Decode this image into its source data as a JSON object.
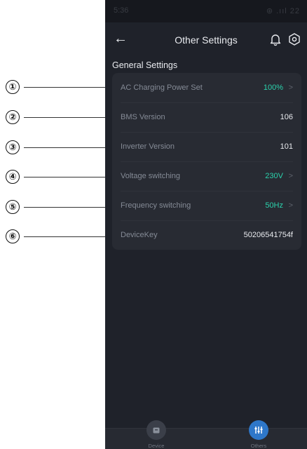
{
  "callouts": [
    "①",
    "②",
    "③",
    "④",
    "⑤",
    "⑥"
  ],
  "status_bar": {
    "time": "5:36",
    "indicators": "⊛ .ııl 22"
  },
  "header": {
    "back_icon": "←",
    "title": "Other Settings"
  },
  "section": {
    "title": "General Settings"
  },
  "settings": [
    {
      "label": "AC Charging Power Set",
      "value": "100%",
      "chevron": ">"
    },
    {
      "label": "BMS Version",
      "value": "106"
    },
    {
      "label": "Inverter Version",
      "value": "101"
    },
    {
      "label": "Voltage switching",
      "value": "230V",
      "chevron": ">"
    },
    {
      "label": "Frequency switching",
      "value": "50Hz",
      "chevron": ">"
    },
    {
      "label": "DeviceKey",
      "value": "50206541754f"
    }
  ],
  "bottom_nav": {
    "device": "Device",
    "others": "Others"
  },
  "colors": {
    "accent_teal": "#2bd3ad",
    "nav_active": "#2e77c9",
    "background": "#1f222a"
  }
}
